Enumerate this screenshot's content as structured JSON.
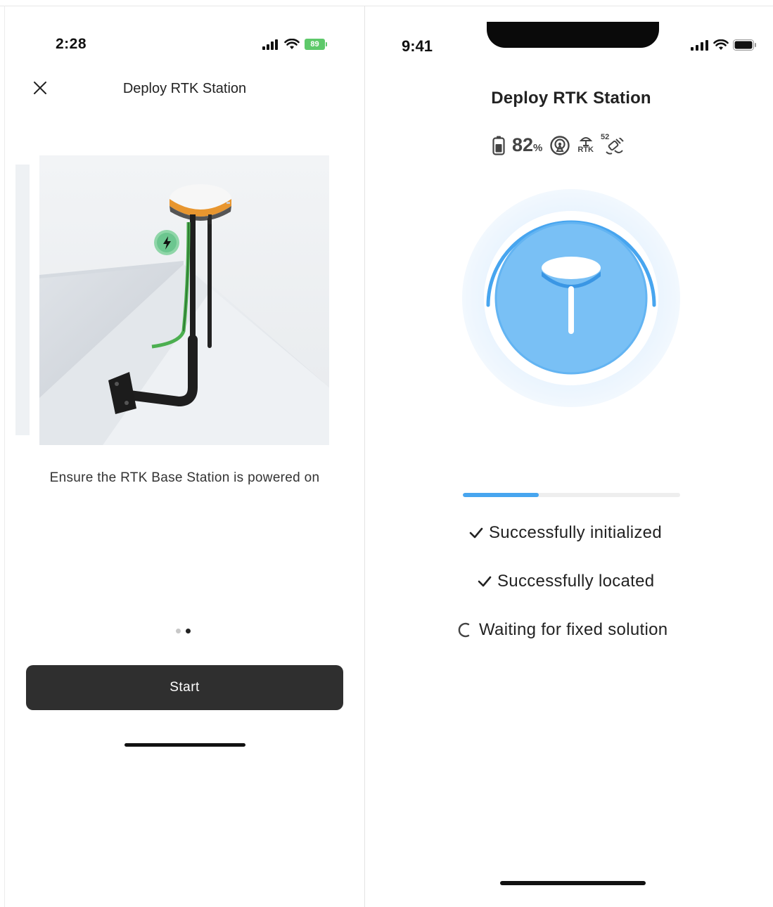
{
  "left_screen": {
    "status_bar": {
      "time": "2:28",
      "battery": "89"
    },
    "header": {
      "title": "Deploy RTK Station"
    },
    "instruction": "Ensure the RTK Base Station is powered on",
    "pagination": {
      "total": 2,
      "active": 2
    },
    "start_button": "Start"
  },
  "right_screen": {
    "status_bar": {
      "time": "9:41"
    },
    "header": {
      "title": "Deploy RTK Station"
    },
    "indicators": {
      "battery_value": "82",
      "battery_unit": "%",
      "rtk_label": "RTK",
      "satellite_count": "52"
    },
    "progress_fraction": 0.35,
    "steps": [
      {
        "label": "Successfully initialized",
        "state": "done"
      },
      {
        "label": "Successfully located",
        "state": "done"
      },
      {
        "label": "Waiting for fixed solution",
        "state": "loading"
      }
    ]
  },
  "colors": {
    "accent_blue": "#47a5ef",
    "charge_green": "#5ec96a",
    "button_dark": "#2f2f2f"
  }
}
